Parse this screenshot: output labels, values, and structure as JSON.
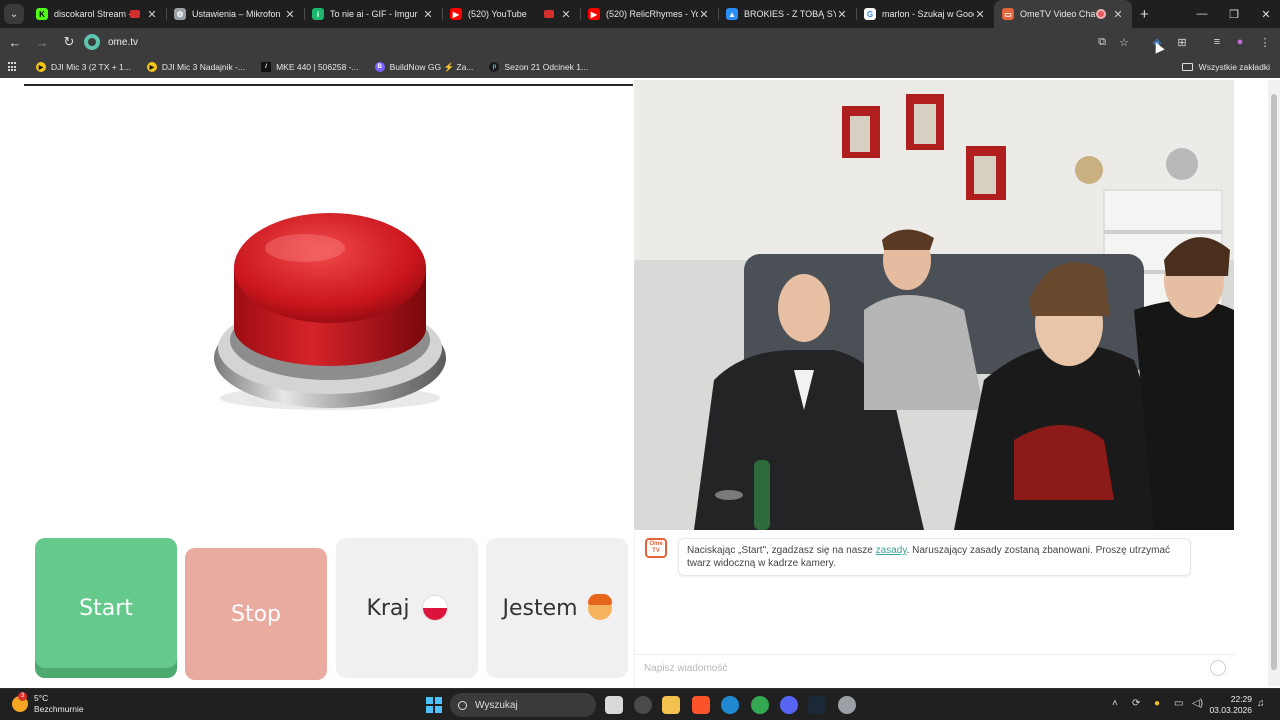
{
  "tabs": [
    {
      "title": "discokarol Stream - W",
      "favicon_color": "#53fc18",
      "favicon": "kick-icon",
      "audio": true
    },
    {
      "title": "Ustawienia – Mikrofon",
      "favicon_color": "#9aa0a6",
      "favicon": "settings-icon",
      "audio": false
    },
    {
      "title": "To nie ai - GIF - Imgur",
      "favicon_color": "#1bb76e",
      "favicon": "imgur-icon",
      "audio": false
    },
    {
      "title": "(520) YouTube",
      "favicon_color": "#ff0000",
      "favicon": "youtube-icon",
      "audio": false
    },
    {
      "title": "(520) RelicRhymes - YouTu",
      "favicon_color": "#ff0000",
      "favicon": "youtube-icon",
      "audio": true
    },
    {
      "title": "BROKIES - Z TOBĄ SYNA",
      "favicon_color": "#2b8ef7",
      "favicon": "drive-icon",
      "audio": false
    },
    {
      "title": "marlon - Szukaj w Google",
      "favicon_color": "#ffffff",
      "favicon": "google-icon",
      "audio": false
    },
    {
      "title": "OmeTV Video Chat –",
      "favicon_color": "#e4633a",
      "favicon": "ometv-icon",
      "audio": false,
      "recording": true,
      "active": true
    }
  ],
  "address_bar": {
    "url": "ome.tv"
  },
  "bookmarks": [
    {
      "label": "DJI Mic 3 (2 TX + 1...",
      "icon_color": "#f5c518"
    },
    {
      "label": "DJI Mic 3 Nadajnik -...",
      "icon_color": "#f5c518"
    },
    {
      "label": "MKE 440 | 506258 -...",
      "icon_color": "#111111"
    },
    {
      "label": "BuildNow GG ⚡ Za...",
      "icon_color": "#7b61ff"
    },
    {
      "label": "Sezon 21 Odcinek 1...",
      "icon_color": "#1a1a1a"
    }
  ],
  "all_bookmarks_label": "Wszystkie zakładki",
  "controls": {
    "start": "Start",
    "stop": "Stop",
    "country": "Kraj",
    "gender": "Jestem"
  },
  "chat": {
    "logo_text": "Ome TV",
    "message_before": "Naciskając „Start\", zgadzasz się na nasze ",
    "message_link": "zasady",
    "message_after": ". Naruszający zasady zostaną zbanowani. Proszę utrzymać twarz widoczną w kadrze kamery.",
    "input_placeholder": "Napisz wiadomość"
  },
  "taskbar": {
    "temperature": "5°C",
    "weather": "Bezchmurnie",
    "weather_badge": "3",
    "search_placeholder": "Wyszukaj",
    "time": "22:29",
    "date": "03.03.2026"
  },
  "colors": {
    "start": "#65c98b",
    "stop": "#e9aa9f",
    "accent_link": "#3aa39a"
  }
}
